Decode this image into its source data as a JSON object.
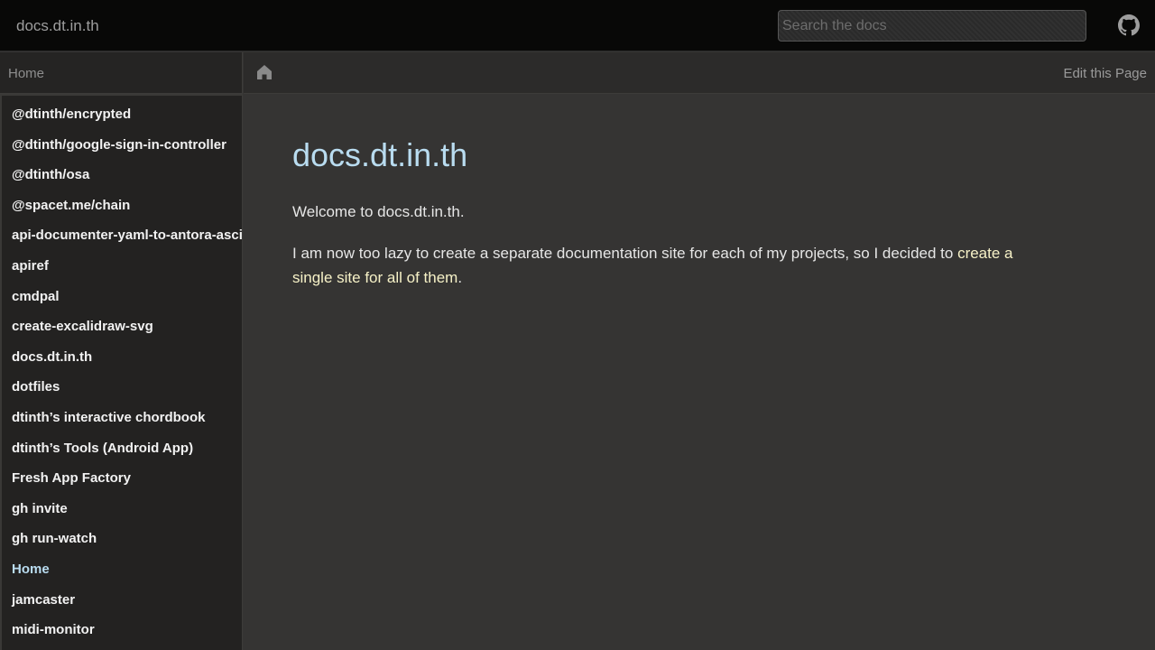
{
  "header": {
    "brand": "docs.dt.in.th",
    "search_placeholder": "Search the docs",
    "github_icon": "github-icon"
  },
  "sidebar": {
    "heading": "Home",
    "items": [
      {
        "label": "@dtinth/encrypted"
      },
      {
        "label": "@dtinth/google-sign-in-controller"
      },
      {
        "label": "@dtinth/osa"
      },
      {
        "label": "@spacet.me/chain"
      },
      {
        "label": "api-documenter-yaml-to-antora-asciidoc"
      },
      {
        "label": "apiref"
      },
      {
        "label": "cmdpal"
      },
      {
        "label": "create-excalidraw-svg"
      },
      {
        "label": "docs.dt.in.th"
      },
      {
        "label": "dotfiles"
      },
      {
        "label": "dtinth’s interactive chordbook"
      },
      {
        "label": "dtinth’s Tools (Android App)"
      },
      {
        "label": "Fresh App Factory"
      },
      {
        "label": "gh invite"
      },
      {
        "label": "gh run-watch"
      },
      {
        "label": "Home",
        "current": true
      },
      {
        "label": "jamcaster"
      },
      {
        "label": "midi-monitor"
      }
    ]
  },
  "toolbar": {
    "home_icon": "home-icon",
    "edit_label": "Edit this Page"
  },
  "main": {
    "title": "docs.dt.in.th",
    "welcome": "Welcome to docs.dt.in.th.",
    "intro_text": "I am now too lazy to create a separate documentation site for each of my projects, so I decided to ",
    "intro_link": "create a single site for all of them",
    "intro_end": "."
  },
  "colors": {
    "navbar_bg": "#080807",
    "content_bg": "#353433",
    "title": "#b9dcf0",
    "link": "#f6f1c7"
  }
}
